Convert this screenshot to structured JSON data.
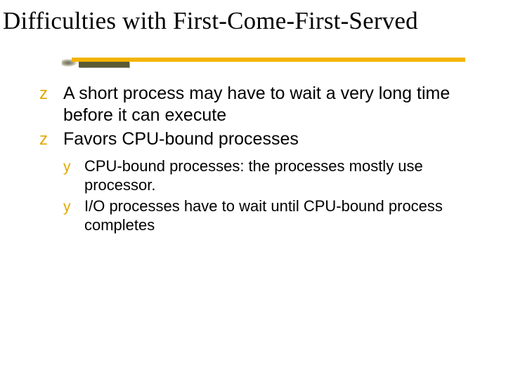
{
  "title": "Difficulties with First-Come-First-Served",
  "bullets": {
    "z": [
      "A short process may have to wait a very long time before it can execute",
      "Favors CPU-bound processes"
    ],
    "y": [
      "CPU-bound processes: the processes mostly use processor.",
      "I/O processes have to wait until CPU-bound process completes"
    ]
  },
  "colors": {
    "bullet": "#e0a800",
    "underline_main": "#f2b400",
    "underline_accent": "#5b5a33"
  }
}
